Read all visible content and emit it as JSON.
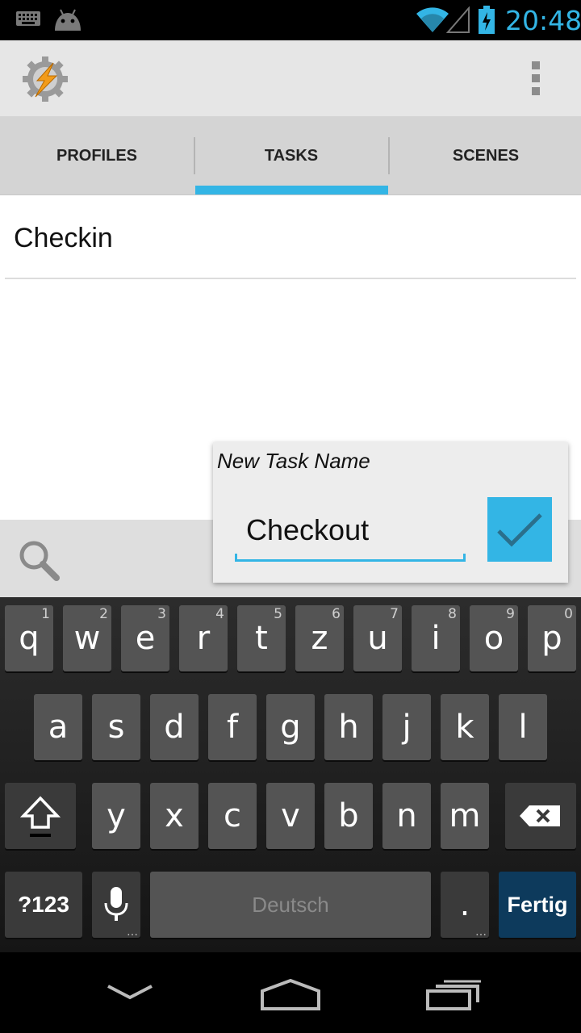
{
  "statusbar": {
    "time": "20:48"
  },
  "tabs": [
    {
      "label": "PROFILES"
    },
    {
      "label": "TASKS"
    },
    {
      "label": "SCENES"
    }
  ],
  "tasks": [
    {
      "name": "Checkin"
    }
  ],
  "dialog": {
    "title": "New Task Name",
    "input_value": "Checkout"
  },
  "keyboard": {
    "row1": [
      {
        "key": "q",
        "hint": "1"
      },
      {
        "key": "w",
        "hint": "2"
      },
      {
        "key": "e",
        "hint": "3"
      },
      {
        "key": "r",
        "hint": "4"
      },
      {
        "key": "t",
        "hint": "5"
      },
      {
        "key": "z",
        "hint": "6"
      },
      {
        "key": "u",
        "hint": "7"
      },
      {
        "key": "i",
        "hint": "8"
      },
      {
        "key": "o",
        "hint": "9"
      },
      {
        "key": "p",
        "hint": "0"
      }
    ],
    "row2": [
      "a",
      "s",
      "d",
      "f",
      "g",
      "h",
      "j",
      "k",
      "l"
    ],
    "row3": [
      "y",
      "x",
      "c",
      "v",
      "b",
      "n",
      "m"
    ],
    "symbols_label": "?123",
    "space_label": "Deutsch",
    "period_label": ".",
    "enter_label": "Fertig"
  },
  "colors": {
    "accent": "#33b5e5",
    "enter_key": "#0d3a5c"
  }
}
